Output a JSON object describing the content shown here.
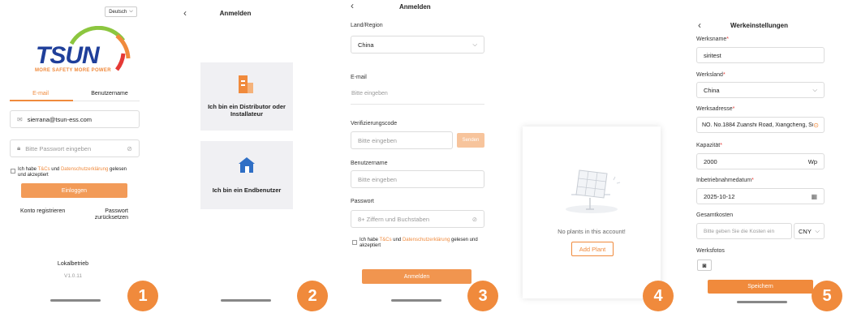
{
  "screen1": {
    "lang": "Deutsch",
    "brand": "TSUN",
    "slogan": "MORE SAFETY MORE POWER",
    "tab_email": "E-mail",
    "tab_user": "Benutzername",
    "email_value": "sierrana@tsun-ess.com",
    "password_placeholder": "Bitte Passwort eingeben",
    "agree_pre": "Ich habe ",
    "agree_tcs": "T&Cs",
    "agree_mid": " und ",
    "agree_privacy": "Datenschutzerklärung",
    "agree_post": " gelesen und akzeptiert",
    "login_button": "Einloggen",
    "register_link": "Konto registrieren",
    "reset_link": "Passwort zurücksetzen",
    "local_op": "Lokalbetrieb",
    "version": "V1.0.11",
    "step": "1"
  },
  "screen2": {
    "title": "Anmelden",
    "card1_label": "Ich bin ein Distributor oder Installateur",
    "card2_label": "Ich bin ein Endbenutzer",
    "step": "2"
  },
  "screen3": {
    "title": "Anmelden",
    "region_label": "Land/Region",
    "region_value": "China",
    "email_label": "E-mail",
    "email_placeholder": "Bitte eingeben",
    "code_label": "Verifizierungscode",
    "code_placeholder": "Bitte eingeben",
    "code_button": "Senden",
    "user_label": "Benutzername",
    "user_placeholder": "Bitte eingeben",
    "pw_label": "Passwort",
    "pw_placeholder": "8+ Ziffern und Buchstaben",
    "agree_pre": "Ich habe ",
    "agree_tcs": "T&Cs",
    "agree_mid": " und ",
    "agree_privacy": "Datenschutzerklärung",
    "agree_post": " gelesen und akzeptiert",
    "submit": "Anmelden",
    "step": "3"
  },
  "screen4": {
    "empty_text": "No plants in this account!",
    "add_button": "Add Plant",
    "step": "4"
  },
  "screen5": {
    "title": "Werkeinstellungen",
    "name_label": "Werksname",
    "name_value": "siritest",
    "country_label": "Werksland",
    "country_value": "China",
    "address_label": "Werksadresse",
    "address_value": "NO. No.1884 Zuanshi Road, Xiangcheng, Suzh",
    "capacity_label": "Kapazität",
    "capacity_value": "2000",
    "capacity_unit": "Wp",
    "date_label": "Inbetriebnahmedatum",
    "date_value": "2025-10-12",
    "cost_label": "Gesamtkosten",
    "cost_placeholder": "Bitte geben Sie die Kosten ein",
    "currency": "CNY",
    "photos_label": "Werksfotos",
    "save": "Speichern",
    "step": "5"
  },
  "colors": {
    "accent": "#f08a3c",
    "brand_blue": "#1f3f9a",
    "brand_green": "#8cc63f"
  }
}
